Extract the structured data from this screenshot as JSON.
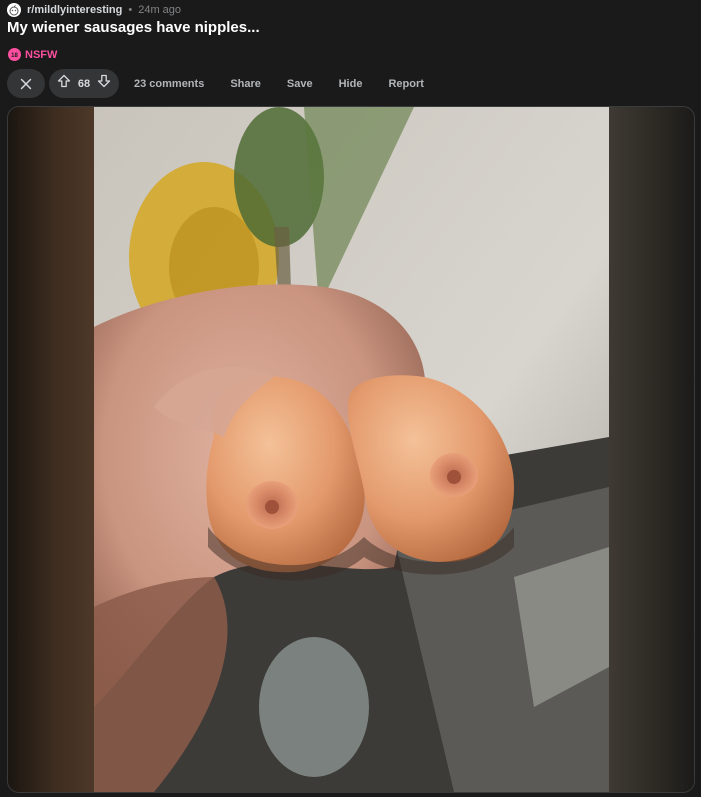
{
  "post": {
    "subreddit": "r/mildlyinteresting",
    "separator": "•",
    "time_ago": "24m ago",
    "title": "My wiener sausages have nipples...",
    "nsfw_label": "NSFW"
  },
  "actions": {
    "close_icon": "close-icon",
    "upvote_icon": "arrow-up-icon",
    "downvote_icon": "arrow-down-icon",
    "vote_count": "68",
    "comments": "23 comments",
    "share": "Share",
    "save": "Save",
    "hide": "Hide",
    "report": "Report"
  },
  "colors": {
    "background": "#1a1a1b",
    "pill": "#343536",
    "nsfw": "#ff4fa0",
    "text_primary": "#ffffff",
    "text_muted": "#818384"
  }
}
